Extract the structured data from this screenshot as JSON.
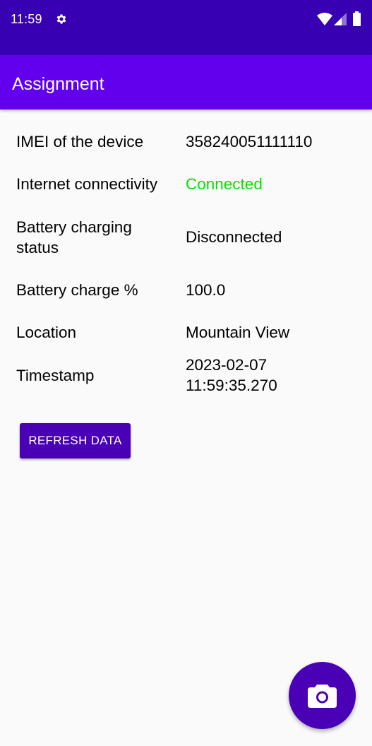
{
  "status_bar": {
    "time": "11:59",
    "icons": [
      "gear-icon",
      "wifi-icon",
      "signal-icon",
      "battery-icon"
    ]
  },
  "app_bar": {
    "title": "Assignment"
  },
  "info": {
    "rows": [
      {
        "label": "IMEI of the device",
        "value": "358240051111110"
      },
      {
        "label": "Internet connectivity",
        "value": "Connected"
      },
      {
        "label": "Battery charging status",
        "value": "Disconnected"
      },
      {
        "label": "Battery charge %",
        "value": "100.0"
      },
      {
        "label": "Location",
        "value": "Mountain View"
      },
      {
        "label": "Timestamp",
        "value": "2023-02-07 11:59:35.270"
      }
    ]
  },
  "actions": {
    "refresh_label": "REFRESH DATA",
    "fab_icon": "camera-icon"
  },
  "colors": {
    "status_bar": "#3700b3",
    "app_bar": "#6200ee",
    "button": "#4a00b5",
    "connected": "#00e400"
  }
}
